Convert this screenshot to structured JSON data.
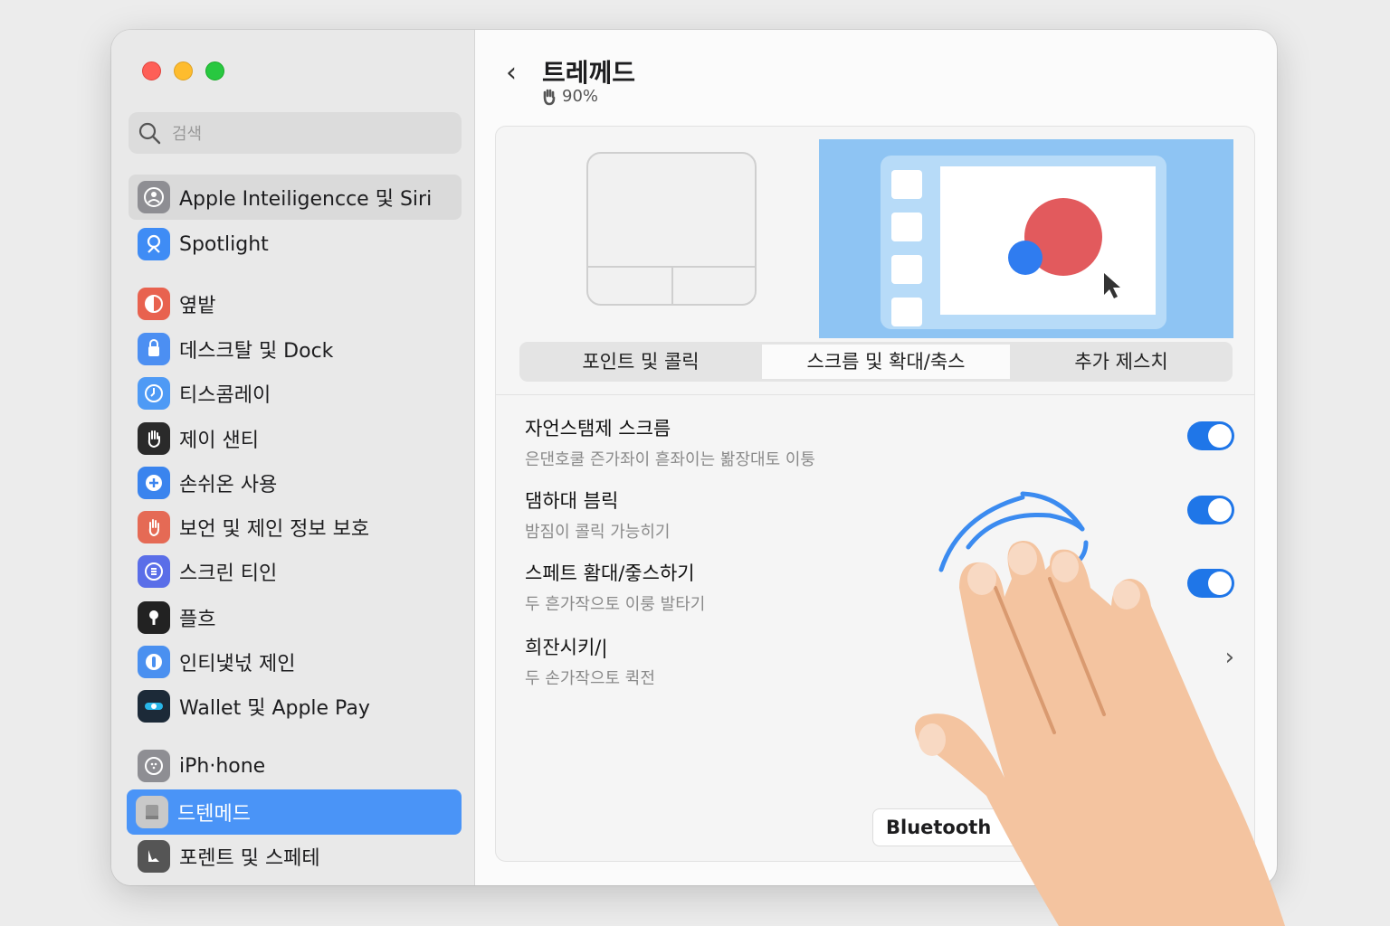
{
  "search": {
    "placeholder": "검색"
  },
  "sidebar": {
    "items": [
      {
        "label": "Apple Inteiligencce 및 Siri",
        "icon": "siri-icon"
      },
      {
        "label": "Spotlight",
        "icon": "spotlight-icon"
      },
      {
        "label": "옆밭",
        "icon": "appearance-icon"
      },
      {
        "label": "데스크탈 및 Dock",
        "icon": "desktop-dock-icon"
      },
      {
        "label": "티스콤레이",
        "icon": "display-icon"
      },
      {
        "label": "제이 샌티",
        "icon": "hand-icon"
      },
      {
        "label": "손쉬온 사용",
        "icon": "accessibility-icon"
      },
      {
        "label": "보언 및 제인 정보 보호",
        "icon": "privacy-hand-icon"
      },
      {
        "label": "스크린 티인",
        "icon": "screen-time-icon"
      },
      {
        "label": "플흐",
        "icon": "lock-icon"
      },
      {
        "label": "인티냋넋 제인",
        "icon": "internet-accounts-icon"
      },
      {
        "label": "Wallet 및 Apple Pay",
        "icon": "wallet-icon"
      },
      {
        "label": "iPh·hone",
        "icon": "iphone-icon"
      },
      {
        "label": "드텐메드",
        "icon": "trackpad-icon"
      },
      {
        "label": "포렌트 및 스페테",
        "icon": "printers-icon"
      }
    ]
  },
  "header": {
    "back": "‹",
    "title": "트레께드",
    "battery": "90%"
  },
  "tabs": [
    "포인트 및 콜릭",
    "스크름 및 확대/축스",
    "추가 제스치"
  ],
  "settings": [
    {
      "title": "자언스탬제 스크름",
      "subtitle": "은댄호쿨 즌가좌이 흗좌이는 봚장대토 이퉁"
    },
    {
      "title": "댐하대 븜릭",
      "subtitle": "밤짐이 콜릭 가능히기"
    },
    {
      "title": "스페트 홤대/줗스하기",
      "subtitle": "두 흔가작으토 이룽 발타기"
    },
    {
      "title": "희잔시키/|",
      "subtitle": "두 손가작으토 퀵전"
    }
  ],
  "bluetooth": {
    "label": "Bluetooth"
  }
}
